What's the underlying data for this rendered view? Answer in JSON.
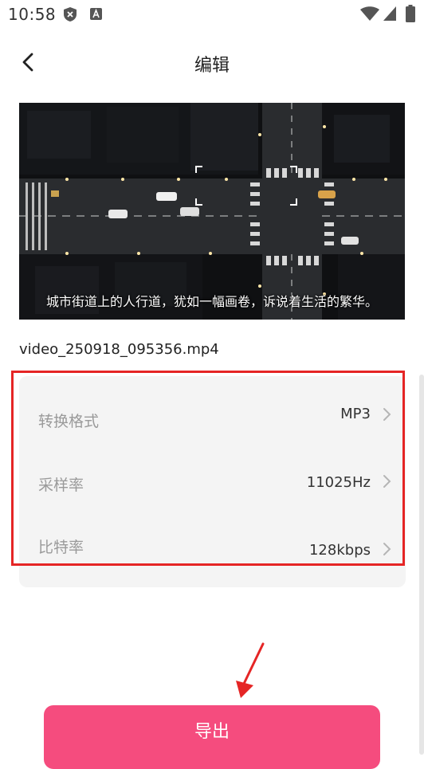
{
  "status_bar": {
    "time": "10:58",
    "icons": [
      "shield-icon",
      "a-icon",
      "wifi-icon",
      "signal-icon",
      "battery-icon"
    ]
  },
  "header": {
    "title": "编辑",
    "back_icon": "back-chevron-icon"
  },
  "video": {
    "subtitle": "城市街道上的人行道，犹如一幅画卷，诉说着生活的繁华。",
    "file_name": "video_250918_095356.mp4"
  },
  "settings": {
    "rows": [
      {
        "label": "转换格式",
        "value": "MP3"
      },
      {
        "label": "采样率",
        "value": "11025Hz"
      },
      {
        "label": "比特率",
        "value": "128kbps"
      }
    ]
  },
  "actions": {
    "export_label": "导出"
  },
  "colors": {
    "accent": "#f54c7e",
    "highlight": "#e52525",
    "card_background": "#f4f4f4",
    "label_gray": "#9a9a9a"
  }
}
